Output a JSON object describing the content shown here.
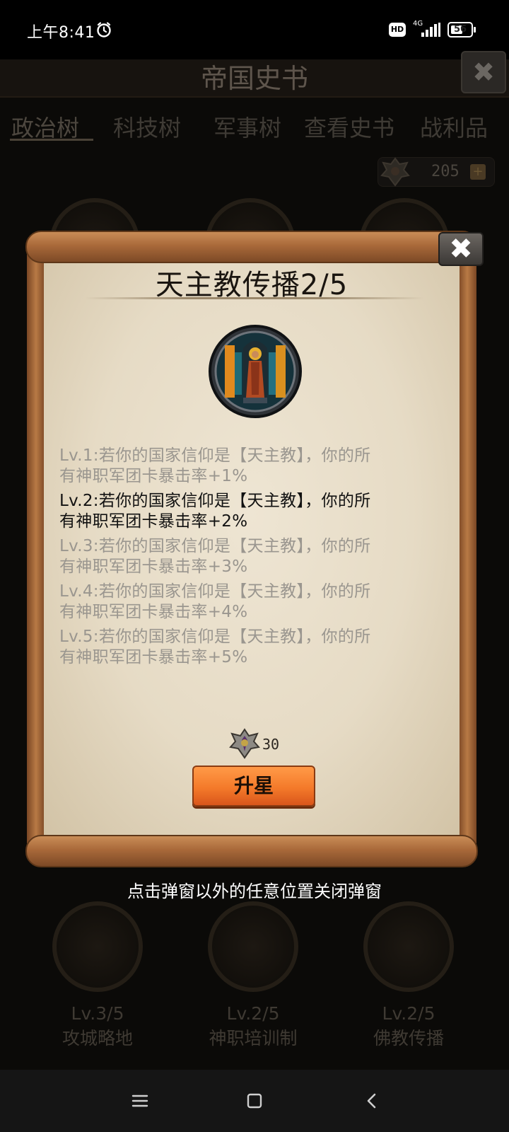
{
  "status_bar": {
    "time": "上午8:41",
    "network": "4G",
    "battery": "56",
    "battery_level": 0.56,
    "hd_label": "HD",
    "icons": [
      "alarm-icon",
      "signal-icon",
      "battery-icon"
    ]
  },
  "game": {
    "title": "帝国史书",
    "close_label": "✖",
    "tabs": [
      {
        "label": "政治树",
        "active": true
      },
      {
        "label": "科技树",
        "active": false
      },
      {
        "label": "军事树",
        "active": false
      },
      {
        "label": "查看史书",
        "active": false
      },
      {
        "label": "战利品",
        "active": false
      }
    ],
    "currency": {
      "value": "205",
      "plus": "+"
    },
    "bottom_nodes": [
      {
        "level": "Lv.3/5",
        "name": "攻城略地"
      },
      {
        "level": "Lv.2/5",
        "name": "神职培训制"
      },
      {
        "level": "Lv.2/5",
        "name": "佛教传播"
      }
    ]
  },
  "popup": {
    "title": "天主教传播2/5",
    "close_label": "✖",
    "levels": [
      {
        "line1": "Lv.1:若你的国家信仰是【天主教】，你的所",
        "line2": "有神职军团卡暴击率+1%",
        "current": false
      },
      {
        "line1": "Lv.2:若你的国家信仰是【天主教】，你的所",
        "line2": "有神职军团卡暴击率+2%",
        "current": true
      },
      {
        "line1": "Lv.3:若你的国家信仰是【天主教】，你的所",
        "line2": "有神职军团卡暴击率+3%",
        "current": false
      },
      {
        "line1": "Lv.4:若你的国家信仰是【天主教】，你的所",
        "line2": "有神职军团卡暴击率+4%",
        "current": false
      },
      {
        "line1": "Lv.5:若你的国家信仰是【天主教】，你的所",
        "line2": "有神职军团卡暴击率+5%",
        "current": false
      }
    ],
    "cost": "30",
    "upgrade_label": "升星",
    "hint": "点击弹窗以外的任意位置关闭弹窗"
  },
  "colors": {
    "parchment": "#e8dfcc",
    "scroll_wood": "#a9693a",
    "button_orange": "#f47a2a",
    "inactive_text": "#9a968f"
  }
}
